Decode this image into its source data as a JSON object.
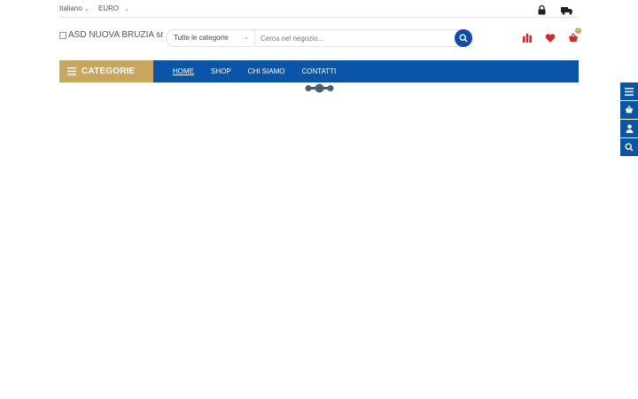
{
  "topbar": {
    "language": "Italiano",
    "currency": "EURO",
    "chevron": "chevron-down-icon",
    "icons": [
      "lock-icon",
      "truck-icon"
    ]
  },
  "header": {
    "logo_alt": "ASD NUOVA BRUZIA sr",
    "search": {
      "category": "Tutte le categorie",
      "placeholder": "Cerca nel negozio...",
      "button_icon": "search-icon"
    },
    "icons": [
      "compare-icon",
      "heart-icon",
      "cart-icon"
    ],
    "cart_count": "0"
  },
  "nav": {
    "categories_label": "CATEGORIE",
    "menu": [
      "HOME",
      "SHOP",
      "CHI SIAMO",
      "CONTATTI"
    ],
    "active": "HOME"
  },
  "sidebar": {
    "icons": [
      "menu-icon",
      "basket-icon",
      "user-icon",
      "search-icon"
    ]
  },
  "colors": {
    "primary": "#0b55a8",
    "accent": "#c9a65d",
    "icon_red": "#d62828"
  }
}
